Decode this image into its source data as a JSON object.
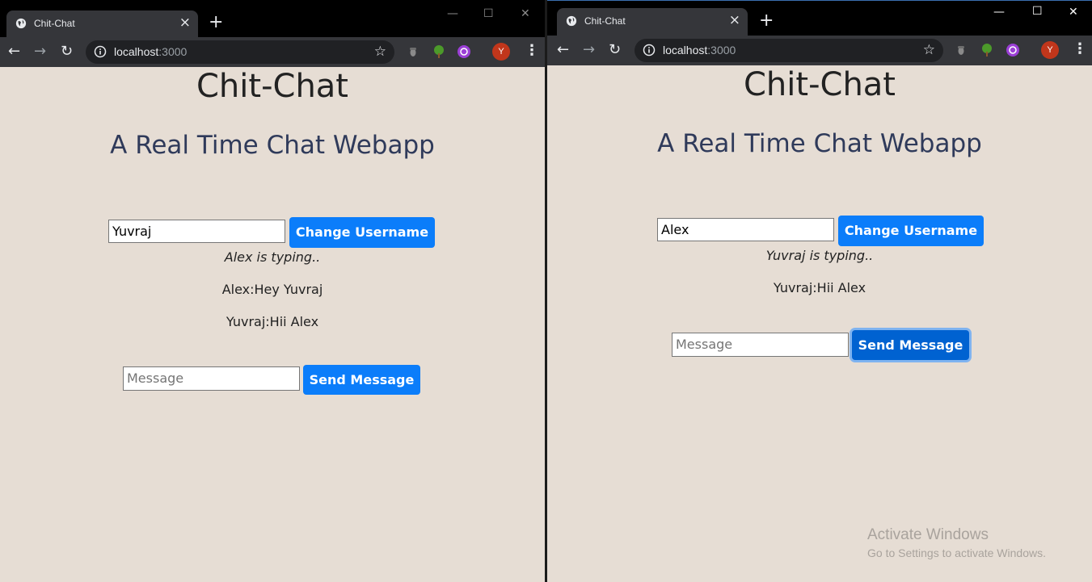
{
  "left_window": {
    "tab": {
      "title": "Chit-Chat",
      "close": "×"
    },
    "new_tab": "+",
    "url": {
      "host": "localhost",
      "port": ":3000"
    },
    "avatar": "Y",
    "page": {
      "title": "Chit-Chat",
      "subtitle": "A Real Time Chat Webapp",
      "username_value": "Yuvraj",
      "change_username_label": "Change Username",
      "typing_text": "Alex is typing..",
      "messages": [
        "Alex:Hey Yuvraj",
        "Yuvraj:Hii Alex"
      ],
      "message_placeholder": "Message",
      "send_label": "Send Message"
    }
  },
  "right_window": {
    "tab": {
      "title": "Chit-Chat",
      "close": "×"
    },
    "new_tab": "+",
    "url": {
      "host": "localhost",
      "port": ":3000"
    },
    "avatar": "Y",
    "window_controls": {
      "minimize": "—",
      "maximize": "☐",
      "close": "✕"
    },
    "page": {
      "title": "Chit-Chat",
      "subtitle": "A Real Time Chat Webapp",
      "username_value": "Alex",
      "change_username_label": "Change Username",
      "typing_text": "Yuvraj is typing..",
      "messages": [
        "Yuvraj:Hii Alex"
      ],
      "message_placeholder": "Message",
      "send_label": "Send Message"
    }
  },
  "watermark": {
    "title": "Activate Windows",
    "subtitle": "Go to Settings to activate Windows."
  },
  "colors": {
    "page_bg": "#e6ddd4",
    "button_blue": "#0b7dfa",
    "subtitle_color": "#2f3a5a"
  }
}
